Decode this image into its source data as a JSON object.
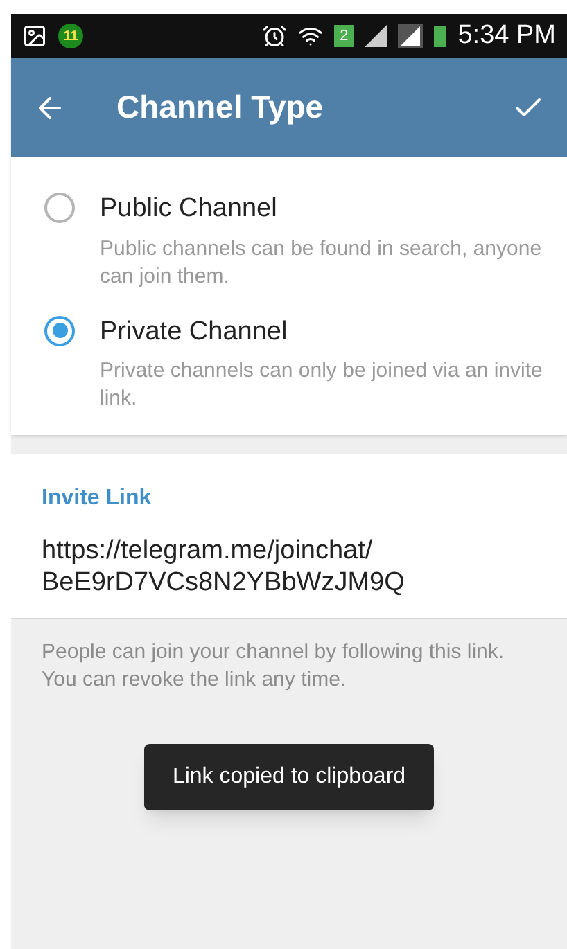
{
  "status_bar": {
    "notification_badge": "11",
    "sim_label": "2",
    "time": "5:34 PM"
  },
  "app_bar": {
    "title": "Channel Type"
  },
  "channel_types": [
    {
      "title": "Public Channel",
      "description": "Public channels can be found in search, anyone can join them.",
      "selected": false
    },
    {
      "title": "Private Channel",
      "description": "Private channels can only be joined via an invite link.",
      "selected": true
    }
  ],
  "invite_link": {
    "header": "Invite Link",
    "value": "https://telegram.me/joinchat/ BeE9rD7VCs8N2YBbWzJM9Q",
    "hint": "People can join your channel by following this link. You can revoke the link any time."
  },
  "toast": {
    "text": "Link copied to clipboard"
  }
}
